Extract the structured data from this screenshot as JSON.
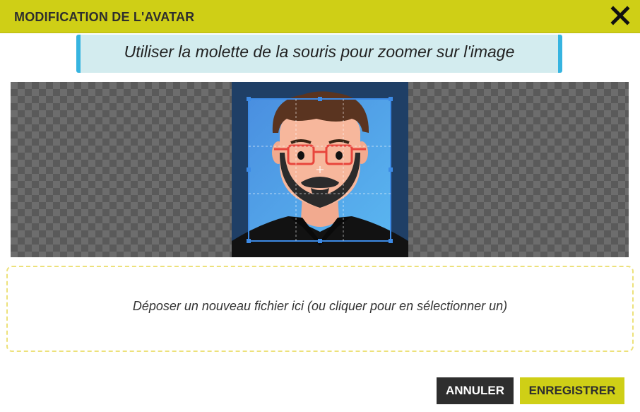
{
  "header": {
    "title": "MODIFICATION DE L'AVATAR"
  },
  "hint": {
    "text": "Utiliser la molette de la souris pour zoomer sur l'image"
  },
  "dropzone": {
    "text": "Déposer un nouveau fichier ici (ou cliquer pour en sélectionner un)"
  },
  "buttons": {
    "cancel": "ANNULER",
    "save": "ENREGISTRER"
  },
  "icons": {
    "close": "close-icon",
    "avatar": "avatar-image"
  },
  "colors": {
    "accent": "#cfcf16",
    "hint_border": "#36b4e0",
    "hint_bg": "#d3ecef",
    "dark": "#2e2e2e"
  }
}
